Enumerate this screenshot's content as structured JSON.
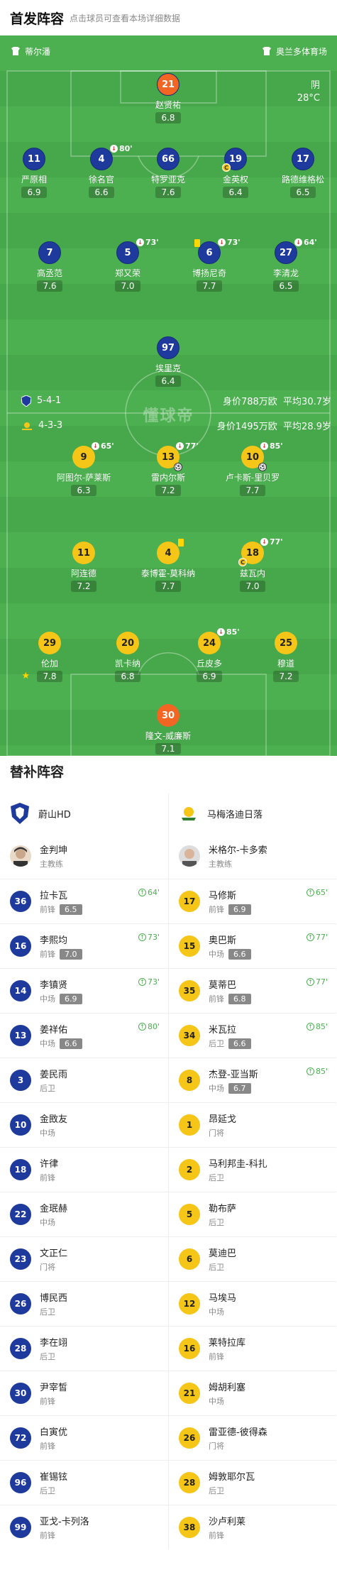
{
  "header": {
    "title": "首发阵容",
    "subtitle": "点击球员可查看本场详细数据"
  },
  "teams": {
    "home": "蒂尔潘",
    "away": "奥兰多体育场"
  },
  "weather": {
    "condition": "阴",
    "temp": "28°C"
  },
  "home_formation": {
    "formation": "5-4-1",
    "value": "身价788万欧",
    "age": "平均30.7岁"
  },
  "away_formation": {
    "formation": "4-3-3",
    "value": "身价1495万欧",
    "age": "平均28.9岁"
  },
  "watermark": "懂球帝",
  "home_players": [
    {
      "num": "21",
      "name": "赵贤祐",
      "rating": "6.8"
    },
    {
      "num": "11",
      "name": "严原相",
      "rating": "6.9"
    },
    {
      "num": "4",
      "name": "徐名官",
      "rating": "6.6",
      "sub": "80'"
    },
    {
      "num": "66",
      "name": "特罗亚克",
      "rating": "7.6"
    },
    {
      "num": "19",
      "name": "金英权",
      "rating": "6.4"
    },
    {
      "num": "17",
      "name": "路德维格松",
      "rating": "6.5"
    },
    {
      "num": "7",
      "name": "高丞范",
      "rating": "7.6"
    },
    {
      "num": "5",
      "name": "郑又荣",
      "rating": "7.0",
      "sub": "73'"
    },
    {
      "num": "6",
      "name": "博扬尼奇",
      "rating": "7.7",
      "sub": "73'"
    },
    {
      "num": "27",
      "name": "李清龙",
      "rating": "6.5",
      "sub": "64'"
    },
    {
      "num": "97",
      "name": "埃里克",
      "rating": "6.4"
    }
  ],
  "away_players": [
    {
      "num": "9",
      "name": "阿图尔-萨莱斯",
      "rating": "6.3",
      "sub": "65'"
    },
    {
      "num": "13",
      "name": "雷内尔斯",
      "rating": "7.2",
      "sub": "77'"
    },
    {
      "num": "10",
      "name": "卢卡斯-里贝罗",
      "rating": "7.7",
      "sub": "85'"
    },
    {
      "num": "11",
      "name": "阿连德",
      "rating": "7.2"
    },
    {
      "num": "4",
      "name": "泰博霍-莫科纳",
      "rating": "7.7"
    },
    {
      "num": "18",
      "name": "兹瓦内",
      "rating": "7.0",
      "sub": "77'"
    },
    {
      "num": "29",
      "name": "伦加",
      "rating": "7.8"
    },
    {
      "num": "20",
      "name": "凯卡纳",
      "rating": "6.8"
    },
    {
      "num": "24",
      "name": "丘皮多",
      "rating": "6.9",
      "sub": "85'"
    },
    {
      "num": "25",
      "name": "穆道",
      "rating": "7.2"
    },
    {
      "num": "30",
      "name": "隆文-威廉斯",
      "rating": "7.1"
    }
  ],
  "subs_title": "替补阵容",
  "home_bench": {
    "club": "蔚山HD",
    "coach": {
      "name": "金判坤",
      "role": "主教练"
    },
    "players": [
      {
        "num": "36",
        "name": "拉卡瓦",
        "pos": "前锋",
        "rating": "6.5",
        "time": "64'"
      },
      {
        "num": "16",
        "name": "李熙均",
        "pos": "前锋",
        "rating": "7.0",
        "time": "73'"
      },
      {
        "num": "14",
        "name": "李镇贤",
        "pos": "中场",
        "rating": "6.9",
        "time": "73'"
      },
      {
        "num": "13",
        "name": "姜祥佑",
        "pos": "中场",
        "rating": "6.6",
        "time": "80'"
      },
      {
        "num": "3",
        "name": "姜民雨",
        "pos": "后卫"
      },
      {
        "num": "10",
        "name": "金敃友",
        "pos": "中场"
      },
      {
        "num": "18",
        "name": "许律",
        "pos": "前锋"
      },
      {
        "num": "22",
        "name": "金珉赫",
        "pos": "中场"
      },
      {
        "num": "23",
        "name": "文正仁",
        "pos": "门将"
      },
      {
        "num": "26",
        "name": "博民西",
        "pos": "后卫"
      },
      {
        "num": "28",
        "name": "李在翊",
        "pos": "后卫"
      },
      {
        "num": "30",
        "name": "尹宰皙",
        "pos": "前锋"
      },
      {
        "num": "72",
        "name": "白寅优",
        "pos": "前锋"
      },
      {
        "num": "96",
        "name": "崔锡铉",
        "pos": "后卫"
      },
      {
        "num": "99",
        "name": "亚戈-卡列洛",
        "pos": "前锋"
      }
    ]
  },
  "away_bench": {
    "club": "马梅洛迪日落",
    "coach": {
      "name": "米格尔-卡多索",
      "role": "主教练"
    },
    "players": [
      {
        "num": "17",
        "name": "马修斯",
        "pos": "前锋",
        "rating": "6.9",
        "time": "65'"
      },
      {
        "num": "15",
        "name": "奥巴斯",
        "pos": "中场",
        "rating": "6.6",
        "time": "77'"
      },
      {
        "num": "35",
        "name": "莫蒂巴",
        "pos": "前锋",
        "rating": "6.8",
        "time": "77'"
      },
      {
        "num": "34",
        "name": "米瓦拉",
        "pos": "后卫",
        "rating": "6.6",
        "time": "85'"
      },
      {
        "num": "8",
        "name": "杰登-亚当斯",
        "pos": "中场",
        "rating": "6.7",
        "time": "85'"
      },
      {
        "num": "1",
        "name": "昂延戈",
        "pos": "门将"
      },
      {
        "num": "2",
        "name": "马利邦圭-科扎",
        "pos": "后卫"
      },
      {
        "num": "5",
        "name": "勒布萨",
        "pos": "后卫"
      },
      {
        "num": "6",
        "name": "莫迪巴",
        "pos": "后卫"
      },
      {
        "num": "12",
        "name": "马埃马",
        "pos": "中场"
      },
      {
        "num": "16",
        "name": "莱特拉库",
        "pos": "前锋"
      },
      {
        "num": "21",
        "name": "姆胡利塞",
        "pos": "中场"
      },
      {
        "num": "26",
        "name": "雷亚德-彼得森",
        "pos": "门将"
      },
      {
        "num": "28",
        "name": "姆敦耶尔瓦",
        "pos": "后卫"
      },
      {
        "num": "38",
        "name": "沙卢利莱",
        "pos": "前锋"
      }
    ]
  },
  "colors": {
    "home": "#1e3a9c",
    "away": "#f5c518",
    "pitch": "#4caf50",
    "keeper": "#f26522"
  }
}
